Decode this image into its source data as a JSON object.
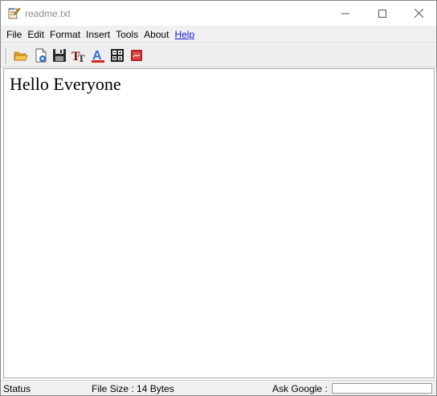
{
  "window": {
    "title": "readme.txt",
    "app_icon": "notepad-pen-icon",
    "controls": [
      "minimize-icon",
      "maximize-icon",
      "close-icon"
    ]
  },
  "menubar": {
    "items": [
      "File",
      "Edit",
      "Format",
      "Insert",
      "Tools",
      "About",
      "Help"
    ]
  },
  "toolbar": {
    "buttons": [
      {
        "icon": "open-folder-icon"
      },
      {
        "icon": "new-document-icon"
      },
      {
        "icon": "save-icon"
      },
      {
        "icon": "font-size-icon"
      },
      {
        "icon": "text-color-icon"
      },
      {
        "icon": "calculator-icon"
      },
      {
        "icon": "pdf-icon"
      }
    ]
  },
  "editor": {
    "content": "Hello Everyone"
  },
  "statusbar": {
    "status": "Status",
    "file_size": "File Size : 14 Bytes",
    "ask_google_label": "Ask Google :",
    "ask_google_value": ""
  },
  "colors": {
    "help_link": "#1a1ad6",
    "title_text": "#8d8d8d",
    "chrome_bg": "#f0f0f0"
  }
}
